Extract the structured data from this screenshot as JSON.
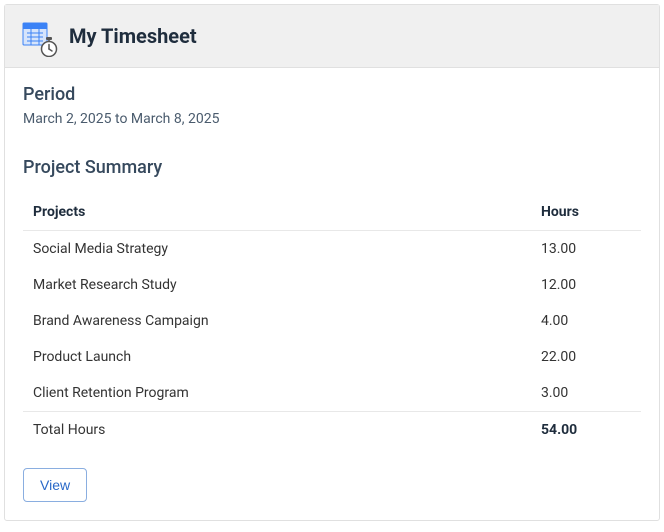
{
  "header": {
    "title": "My Timesheet"
  },
  "period": {
    "label": "Period",
    "value": "March 2, 2025 to March 8, 2025"
  },
  "summary": {
    "title": "Project Summary",
    "columns": {
      "projects": "Projects",
      "hours": "Hours"
    },
    "rows": [
      {
        "project": "Social Media Strategy",
        "hours": "13.00"
      },
      {
        "project": "Market Research Study",
        "hours": "12.00"
      },
      {
        "project": "Brand Awareness Campaign",
        "hours": "4.00"
      },
      {
        "project": "Product Launch",
        "hours": "22.00"
      },
      {
        "project": "Client Retention Program",
        "hours": "3.00"
      }
    ],
    "total": {
      "label": "Total Hours",
      "value": "54.00"
    }
  },
  "actions": {
    "view": "View"
  },
  "colors": {
    "accent_blue": "#3b82f6",
    "header_bg": "#f0f0f0",
    "border": "#e0e0e0",
    "text_dark": "#1f2d3d",
    "text_muted": "#36495d"
  }
}
